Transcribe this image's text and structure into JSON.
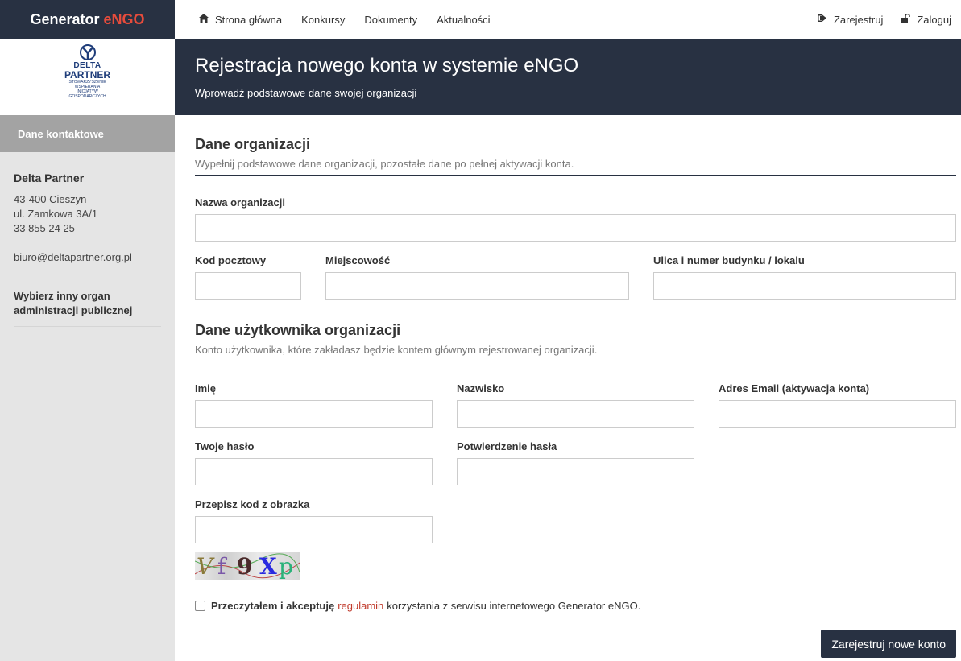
{
  "brand": {
    "name": "Generator",
    "accent": "eNGO"
  },
  "logo": {
    "line1": "DELTA",
    "line2": "PARTNER",
    "line3": "STOWARZYSZENIE",
    "line4": "WSPIERANIA",
    "line5": "INICJATYW",
    "line6": "GOSPODARCZYCH"
  },
  "nav": {
    "items": [
      {
        "label": "Strona główna",
        "icon": "home-icon"
      },
      {
        "label": "Konkursy"
      },
      {
        "label": "Dokumenty"
      },
      {
        "label": "Aktualności"
      }
    ],
    "register": "Zarejestruj",
    "login": "Zaloguj"
  },
  "sidebar": {
    "heading": "Dane kontaktowe",
    "org_name": "Delta Partner",
    "address1": "43-400 Cieszyn",
    "address2": "ul. Zamkowa 3A/1",
    "phone": "33 855 24 25",
    "email": "biuro@deltapartner.org.pl",
    "link_line1": "Wybierz inny organ",
    "link_line2": "administracji publicznej"
  },
  "header": {
    "title": "Rejestracja nowego konta w systemie eNGO",
    "subtitle": "Wprowadź podstawowe dane swojej organizacji"
  },
  "org_section": {
    "title": "Dane organizacji",
    "desc": "Wypełnij podstawowe dane organizacji, pozostałe dane po pełnej aktywacji konta.",
    "name_label": "Nazwa organizacji",
    "postal_label": "Kod pocztowy",
    "city_label": "Miejscowość",
    "street_label": "Ulica i numer budynku / lokalu"
  },
  "user_section": {
    "title": "Dane użytkownika organizacji",
    "desc": "Konto użytkownika, które zakładasz będzie kontem głównym rejestrowanej organizacji.",
    "first_name_label": "Imię",
    "last_name_label": "Nazwisko",
    "email_label": "Adres Email (aktywacja konta)",
    "password_label": "Twoje hasło",
    "password_confirm_label": "Potwierdzenie hasła",
    "captcha_label": "Przepisz kod z obrazka"
  },
  "captcha_chars": [
    "V",
    "f",
    "9",
    "X",
    "p"
  ],
  "terms": {
    "before": "Przeczytałem i akceptuję",
    "link": "regulamin",
    "after": "korzystania z serwisu internetowego Generator eNGO."
  },
  "submit_label": "Zarejestruj nowe konto",
  "colors": {
    "navy": "#283142",
    "accent": "#e74c3c",
    "link": "#c0392b"
  }
}
